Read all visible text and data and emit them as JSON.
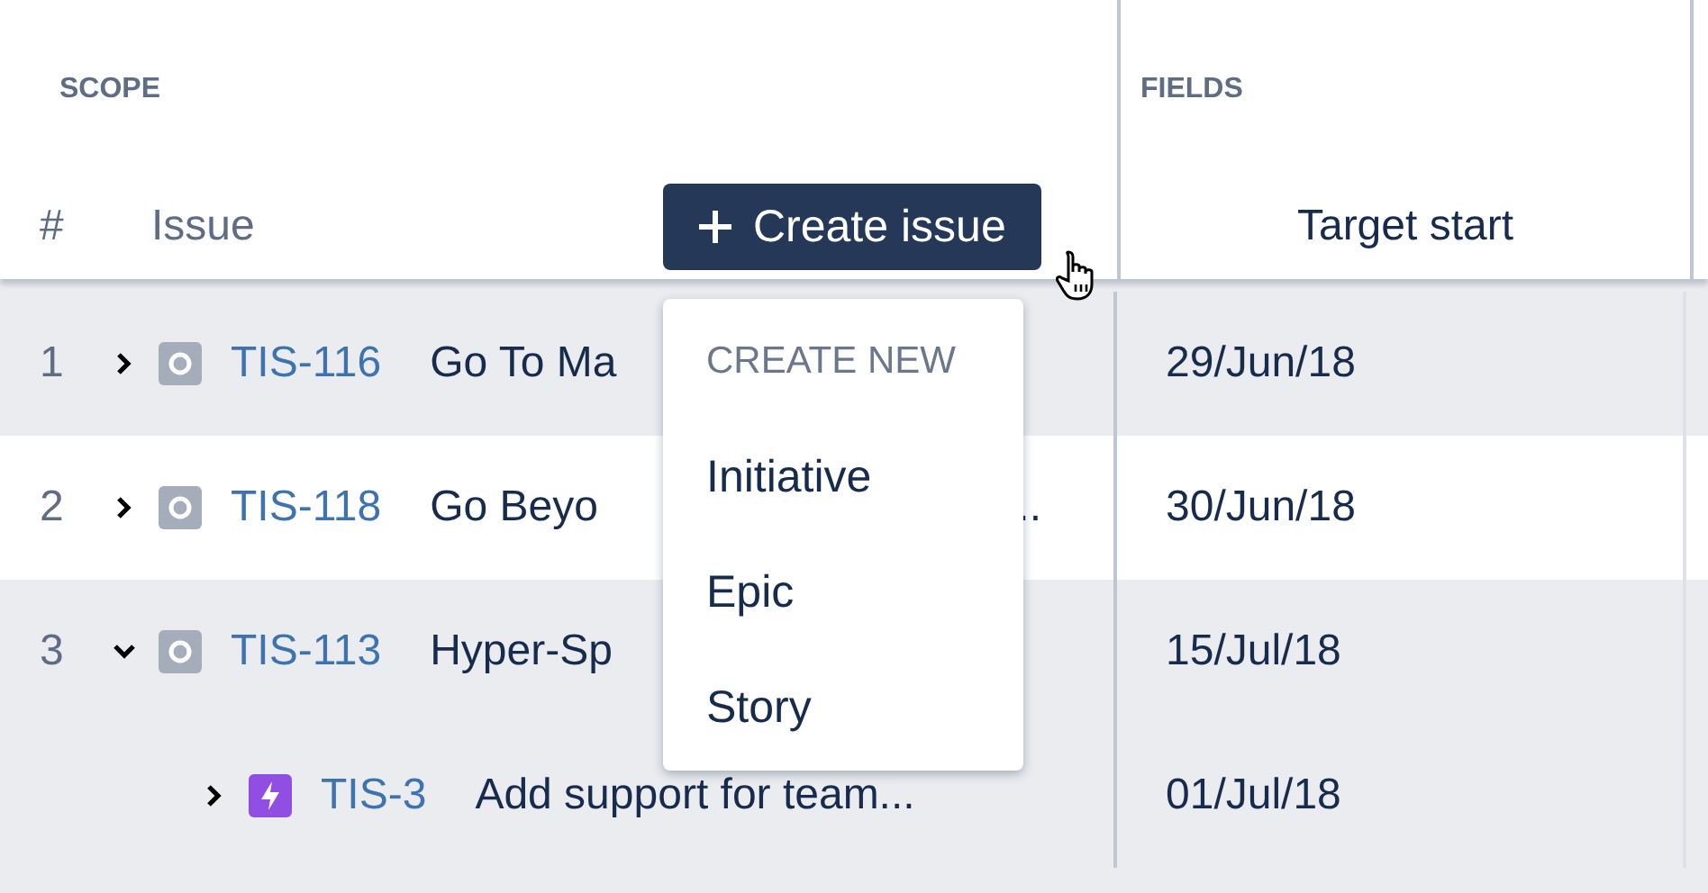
{
  "scope": {
    "title": "SCOPE",
    "columns": [
      "#",
      "Issue"
    ],
    "create_button": "Create issue"
  },
  "fields": {
    "title": "FIELDS",
    "columns": [
      "Target start"
    ]
  },
  "rows": [
    {
      "number": "1",
      "expanded": false,
      "kind": "initiative",
      "key": "TIS-116",
      "summary": "Go To Ma",
      "highlighted": true,
      "target_start": "29/Jun/18"
    },
    {
      "number": "2",
      "expanded": false,
      "kind": "initiative",
      "key": "TIS-118",
      "summary": "Go Beyo",
      "summary_end": "..",
      "highlighted": false,
      "target_start": "30/Jun/18"
    },
    {
      "number": "3",
      "expanded": true,
      "kind": "initiative",
      "key": "TIS-113",
      "summary": "Hyper-Sp",
      "highlighted": true,
      "target_start": "15/Jul/18",
      "children": [
        {
          "expanded": false,
          "kind": "epic",
          "key": "TIS-3",
          "summary": "Add support for team...",
          "highlighted": true,
          "target_start": "01/Jul/18"
        }
      ]
    }
  ],
  "menu": {
    "heading": "CREATE NEW",
    "items": [
      "Initiative",
      "Epic",
      "Story"
    ]
  }
}
